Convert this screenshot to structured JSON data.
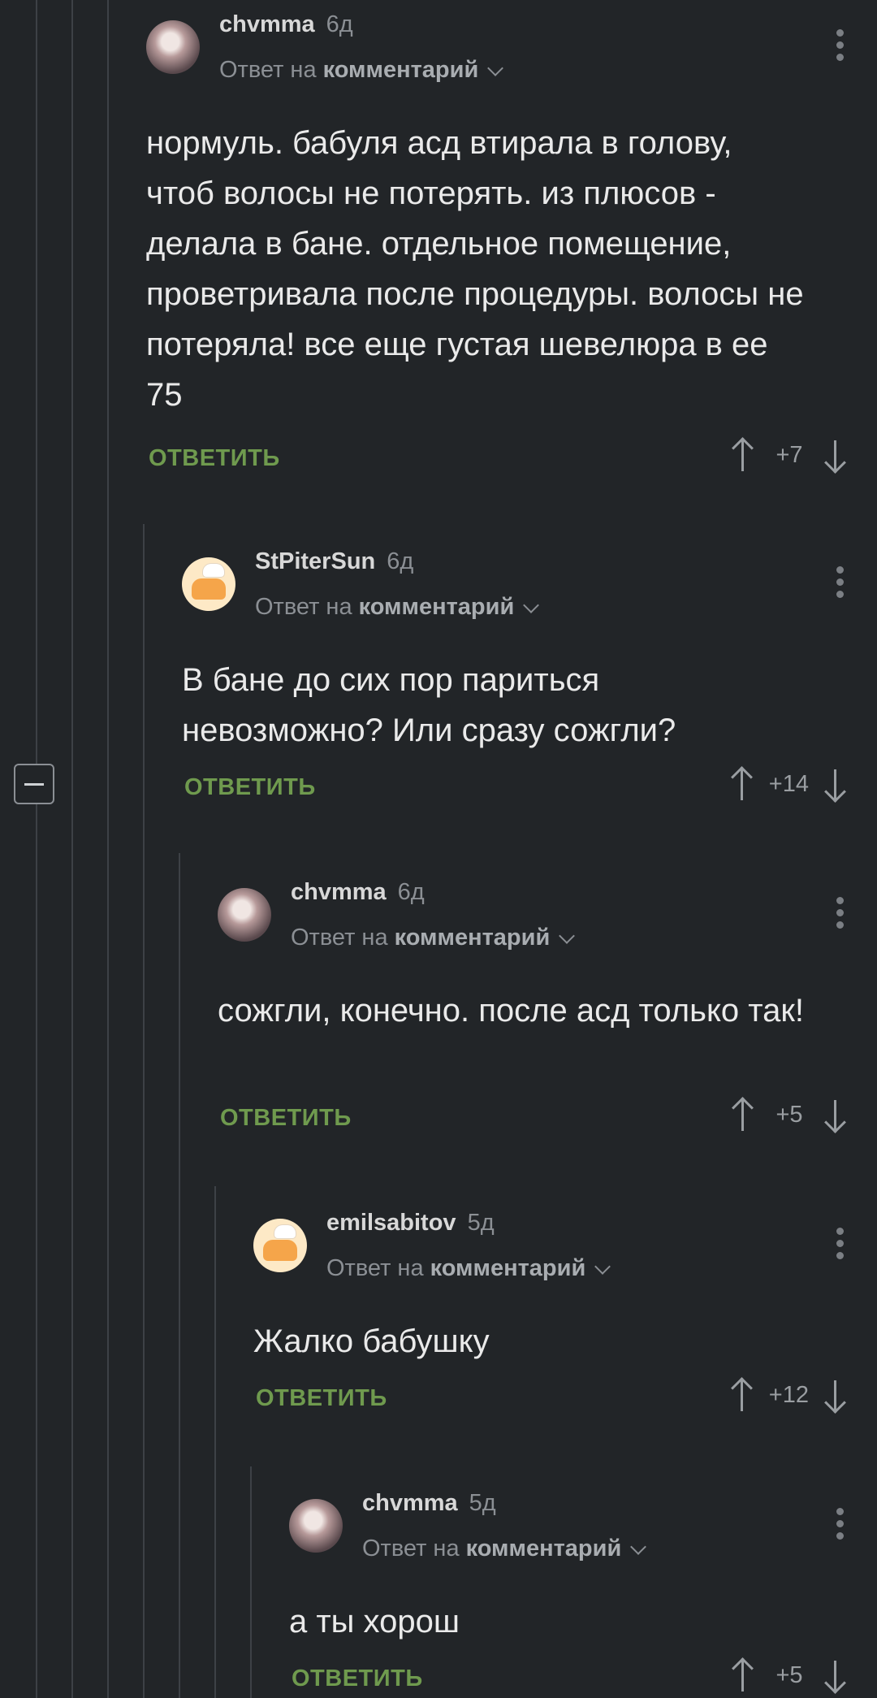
{
  "comments": [
    {
      "username": "chvmma",
      "time": "6д",
      "reply_prefix": "Ответ на",
      "reply_target": "комментарий",
      "text": "нормуль. бабуля асд втирала в голову, чтоб волосы не потерять. из плюсов - делала в бане. отдельное помещение, проветривала после процедуры. волосы не потеряла! все еще густая шевелюра в ее 75",
      "reply_label": "ОТВЕТИТЬ",
      "score": "+7",
      "avatar": "girl-avatar"
    },
    {
      "username": "StPiterSun",
      "time": "6д",
      "reply_prefix": "Ответ на",
      "reply_target": "комментарий",
      "text": "В бане до сих пор париться невозможно? Или сразу сожгли?",
      "reply_label": "ОТВЕТИТЬ",
      "score": "+14",
      "avatar": "chef-avatar"
    },
    {
      "username": "chvmma",
      "time": "6д",
      "reply_prefix": "Ответ на",
      "reply_target": "комментарий",
      "text": "сожгли, конечно. после асд только так!",
      "reply_label": "ОТВЕТИТЬ",
      "score": "+5",
      "avatar": "girl-avatar"
    },
    {
      "username": "emilsabitov",
      "time": "5д",
      "reply_prefix": "Ответ на",
      "reply_target": "комментарий",
      "text": "Жалко бабушку",
      "reply_label": "ОТВЕТИТЬ",
      "score": "+12",
      "avatar": "chef-avatar"
    },
    {
      "username": "chvmma",
      "time": "5д",
      "reply_prefix": "Ответ на",
      "reply_target": "комментарий",
      "text": "а ты хорош",
      "reply_label": "ОТВЕТИТЬ",
      "score": "+5",
      "avatar": "girl-avatar"
    }
  ],
  "colors": {
    "background": "#222528",
    "reply_button": "#6f9a4e",
    "muted": "#8b8f94"
  }
}
